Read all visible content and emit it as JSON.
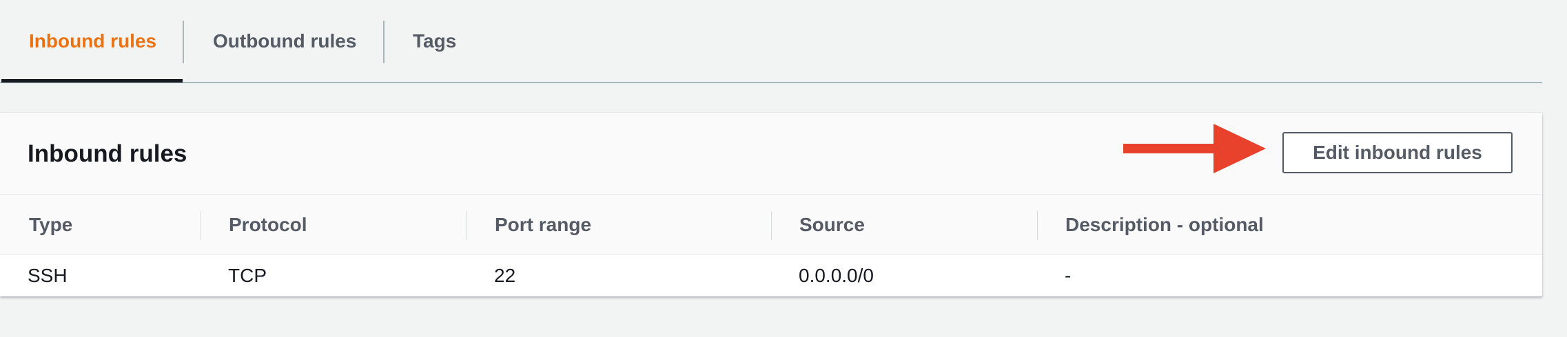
{
  "tabs": [
    {
      "label": "Inbound rules",
      "active": true
    },
    {
      "label": "Outbound rules",
      "active": false
    },
    {
      "label": "Tags",
      "active": false
    }
  ],
  "panel": {
    "title": "Inbound rules",
    "edit_button_label": "Edit inbound rules",
    "annotation_arrow_icon": "right-arrow-icon"
  },
  "table": {
    "columns": [
      "Type",
      "Protocol",
      "Port range",
      "Source",
      "Description - optional"
    ],
    "rows": [
      [
        "SSH",
        "TCP",
        "22",
        "0.0.0.0/0",
        "-"
      ]
    ]
  },
  "colors": {
    "active_tab": "#ec7211",
    "annotation_arrow": "#e8412c",
    "text_dark": "#16191f",
    "text_muted": "#545b64"
  }
}
